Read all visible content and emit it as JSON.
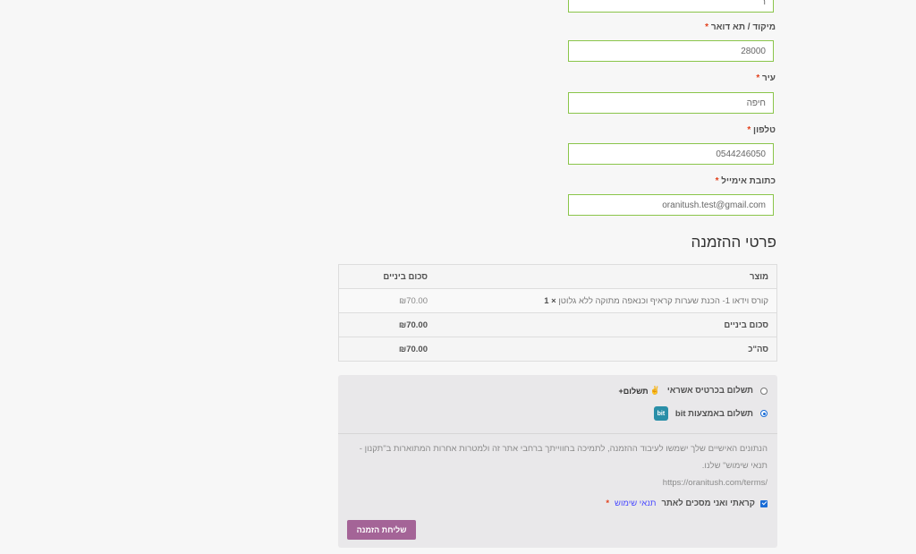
{
  "fields": {
    "partial_value": "ר",
    "zip_label": "מיקוד / תא דואר",
    "zip_value": "28000",
    "city_label": "עיר",
    "city_value": "חיפה",
    "phone_label": "טלפון",
    "phone_value": "0544246050",
    "email_label": "כתובת אימייל",
    "email_value": "oranitush.test@gmail.com",
    "required_mark": "*"
  },
  "order": {
    "title": "פרטי ההזמנה",
    "col_product": "מוצר",
    "col_subtotal": "סכום ביניים",
    "item_name": "קורס וידאו 1- הכנת שערות קראיף וכנאפה מתוקה ללא גלוטן",
    "item_qty": "× 1",
    "item_price": "₪70.00",
    "subtotal_label": "סכום ביניים",
    "subtotal_value": "₪70.00",
    "total_label": "סה\"כ",
    "total_value": "₪70.00"
  },
  "payment": {
    "credit_label": "תשלום בכרטיס אשראי",
    "credit_logo": "תשלום+",
    "bit_label": "תשלום באמצעות bit",
    "bit_logo": "bit",
    "privacy_text": "הנתונים האישיים שלך ישמשו לעיבוד ההזמנה, לתמיכה בחווייתך ברחבי אתר זה ולמטרות אחרות המתוארות ב\"תקנון -תנאי שימוש\" שלנו.",
    "privacy_url": "https://oranitush.com/terms/",
    "terms_text": "קראתי ואני מסכים לאתר",
    "terms_link": "תנאי שימוש",
    "submit_label": "שליחת הזמנה"
  }
}
